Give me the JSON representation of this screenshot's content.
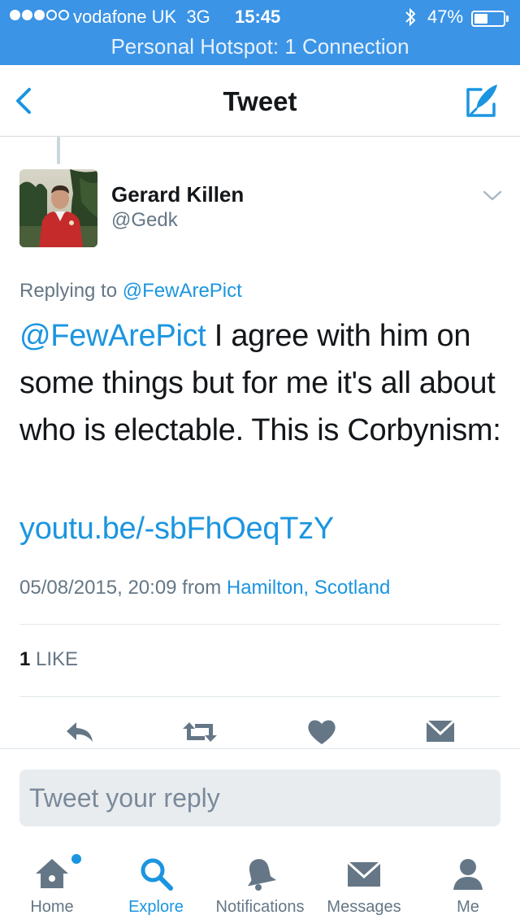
{
  "status_bar": {
    "carrier": "vodafone UK",
    "network": "3G",
    "time": "15:45",
    "battery": "47%",
    "battery_level": 0.47,
    "hotspot": "Personal Hotspot: 1 Connection",
    "color": "#3b94e6"
  },
  "nav": {
    "title": "Tweet",
    "back_icon": "chevron-left-icon",
    "compose_icon": "compose-icon"
  },
  "tweet": {
    "display_name": "Gerard Killen",
    "handle": "@Gedk",
    "replying_prefix": "Replying to",
    "replying_to": "@FewArePict",
    "mention": "@FewArePict",
    "text_body": " I agree with him on some things but for me it's all about who is electable. This is Corbynism:",
    "link": "youtu.be/-sbFhOeqTzY",
    "timestamp": "05/08/2015, 20:09 from",
    "location": "Hamilton, Scotland",
    "like_count": "1",
    "like_label": "LIKE"
  },
  "actions": [
    "reply-icon",
    "retweet-icon",
    "like-icon",
    "message-icon"
  ],
  "reply": {
    "placeholder": "Tweet your reply"
  },
  "tabs": [
    {
      "label": "Home",
      "icon": "home-icon"
    },
    {
      "label": "Explore",
      "icon": "search-icon",
      "active": true
    },
    {
      "label": "Notifications",
      "icon": "bell-icon"
    },
    {
      "label": "Messages",
      "icon": "envelope-icon"
    },
    {
      "label": "Me",
      "icon": "person-icon"
    }
  ],
  "colors": {
    "accent": "#1b95e0",
    "secondary_text": "#657786",
    "icon_gray": "#657786"
  }
}
